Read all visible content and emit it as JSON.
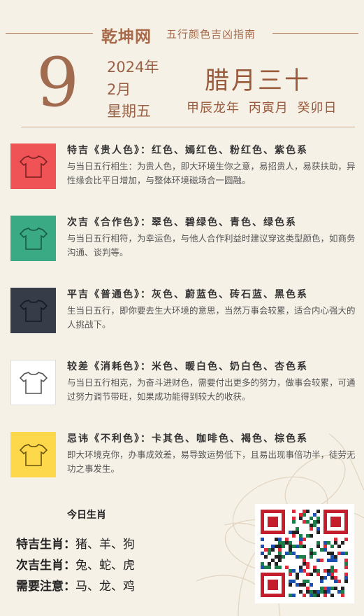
{
  "header": {
    "brand": "乾坤网",
    "subtitle": "五行颜色吉凶指南"
  },
  "date": {
    "day": "9",
    "year": "2024年",
    "month": "2月",
    "weekday": "星期五",
    "lunar": "腊月三十",
    "ganzhi": "甲辰龙年 丙寅月 癸卯日"
  },
  "colors": [
    {
      "title": "特吉《贵人色》：红色、嫣红色、粉红色、紫色系",
      "desc": "与当日五行相生：为贵人色，即大环境生你之意，易招贵人，易获扶助，异性缘会比平日增加，与整体环境磁场合一圆融。",
      "swatch": "#f05355",
      "shirt_stroke": "#7a2020",
      "icon": "tshirt-icon"
    },
    {
      "title": "次吉《合作色》：翠色、碧绿色、青色、绿色系",
      "desc": "与当日五行相符，为幸运色，与他人合作利益时建议穿这类型颜色，如商务沟通、谈判等。",
      "swatch": "#3aaa85",
      "shirt_stroke": "#175a44",
      "icon": "tshirt-icon"
    },
    {
      "title": "平吉《普通色》：灰色、蔚蓝色、砖石蓝、黑色系",
      "desc": "生当日五行，即你要去生大环境的意思，当然万事会较累，适合内心强大的人挑战下。",
      "swatch": "#363d48",
      "shirt_stroke": "#151a22",
      "icon": "tshirt-icon"
    },
    {
      "title": "较差《消耗色》：米色、暖白色、奶白色、杏色系",
      "desc": "与当日五行相克，为奋斗进财色，需要付出更多的努力，做事会较累，可通过努力调节带旺，如果成功能得到较大的收获。",
      "swatch": "#ffffff",
      "shirt_stroke": "#555555",
      "icon": "tshirt-icon"
    },
    {
      "title": "忌讳《不利色》：卡其色、咖啡色、褐色、棕色系",
      "desc": "即大环境克你，办事成效差，易导致运势低下，且易出现事倍功半，徒劳无功之事发生。",
      "swatch": "#fcd84a",
      "shirt_stroke": "#6b5510",
      "icon": "tshirt-icon"
    }
  ],
  "zodiac": {
    "title": "今日生肖",
    "rows": [
      {
        "label": "特吉生肖：",
        "value": "猪、羊、狗"
      },
      {
        "label": "次吉生肖：",
        "value": "兔、蛇、虎"
      },
      {
        "label": "需要注意：",
        "value": "马、龙、鸡"
      }
    ]
  }
}
